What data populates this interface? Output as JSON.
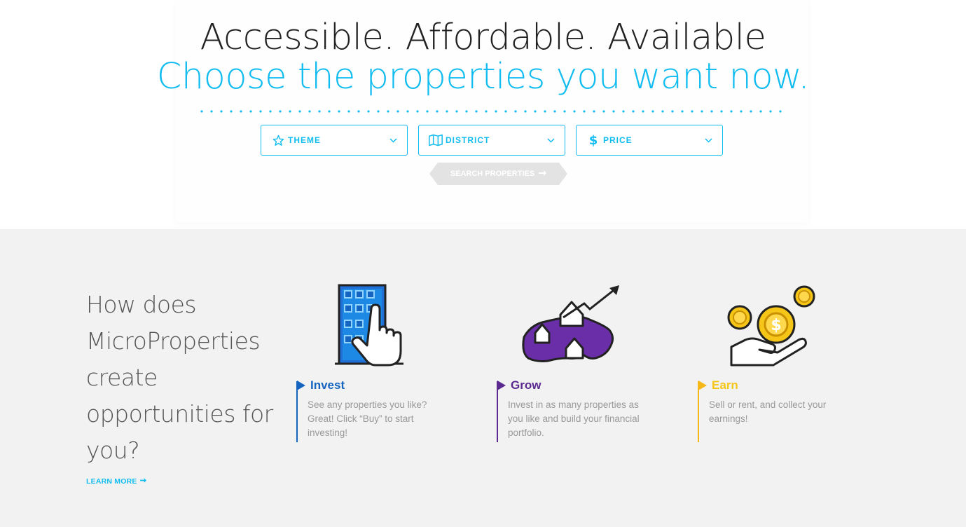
{
  "hero": {
    "headline": "Accessible. Affordable. Available",
    "subheadline": "Choose the properties you want now."
  },
  "filters": [
    {
      "label": "THEME",
      "icon": "star-icon"
    },
    {
      "label": "DISTRICT",
      "icon": "map-icon"
    },
    {
      "label": "PRICE",
      "icon": "dollar-icon"
    }
  ],
  "search_button": {
    "label": "SEARCH PROPERTIES",
    "icon": "arrow-right-icon"
  },
  "how": {
    "title": "How does MicroProperties create opportunities for you?",
    "learn_more": "LEARN MORE"
  },
  "steps": [
    {
      "title": "Invest",
      "description": "See any properties you like? Great! Click “Buy” to start investing!",
      "color": "#1565c0",
      "icon": "building-click-icon"
    },
    {
      "title": "Grow",
      "description": "Invest in as many properties as you like and build your financial portfolio.",
      "color": "#5b2a91",
      "icon": "map-growth-icon"
    },
    {
      "title": "Earn",
      "description": "Sell or rent, and collect your earnings!",
      "color": "#f5c518",
      "icon": "hand-coins-icon"
    }
  ],
  "colors": {
    "accent": "#11bdf0",
    "section_bg": "#f2f2f2"
  }
}
